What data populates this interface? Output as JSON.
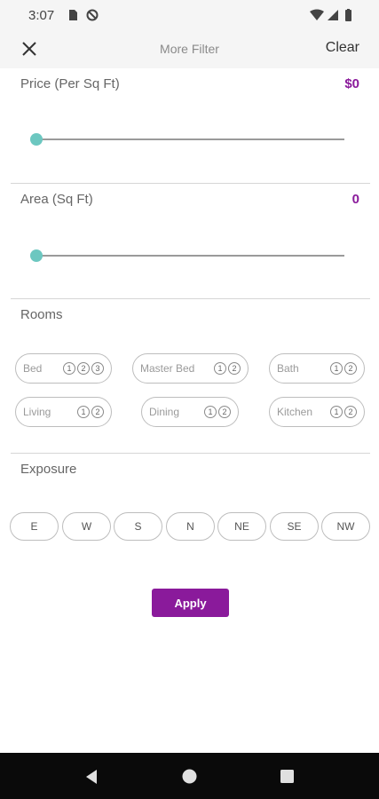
{
  "status_bar": {
    "time": "3:07"
  },
  "toolbar": {
    "title": "More Filter",
    "clear_label": "Clear"
  },
  "price": {
    "label": "Price (Per Sq Ft)",
    "value": "$0",
    "slider_fraction": 0
  },
  "area": {
    "label": "Area (Sq Ft)",
    "value": "0",
    "slider_fraction": 0
  },
  "rooms": {
    "label": "Rooms",
    "items": [
      {
        "name": "Bed",
        "options": [
          "1",
          "2",
          "3"
        ]
      },
      {
        "name": "Master Bed",
        "options": [
          "1",
          "2"
        ]
      },
      {
        "name": "Bath",
        "options": [
          "1",
          "2"
        ]
      },
      {
        "name": "Living",
        "options": [
          "1",
          "2"
        ]
      },
      {
        "name": "Dining",
        "options": [
          "1",
          "2"
        ]
      },
      {
        "name": "Kitchen",
        "options": [
          "1",
          "2"
        ]
      }
    ]
  },
  "exposure": {
    "label": "Exposure",
    "options": [
      "E",
      "W",
      "S",
      "N",
      "NE",
      "SE",
      "NW"
    ]
  },
  "apply_label": "Apply",
  "colors": {
    "accent": "#8a1a9b",
    "slider_thumb": "#6cc7c0"
  }
}
